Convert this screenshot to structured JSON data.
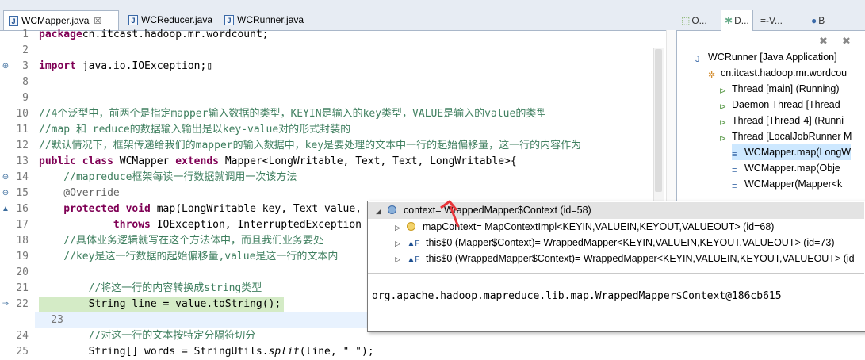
{
  "editor_tabs": [
    {
      "label": "WCMapper.java",
      "close": "☒",
      "active": true
    },
    {
      "label": "WCReducer.java",
      "active": false
    },
    {
      "label": "WCRunner.java",
      "active": false
    }
  ],
  "right_tabs": [
    {
      "label": "O..."
    },
    {
      "label": "D..."
    },
    {
      "label": "=-V..."
    },
    {
      "label": "B"
    }
  ],
  "code_lines": [
    {
      "n": "1",
      "parts": [
        [
          "kw",
          "package"
        ],
        [
          "",
          "cn.itcast.hadoop.mr.wordcount;"
        ]
      ]
    },
    {
      "n": "2",
      "parts": []
    },
    {
      "n": "3",
      "marker": "⊕",
      "parts": [
        [
          "kw",
          "import"
        ],
        [
          "",
          " java.io.IOException;"
        ],
        [
          "",
          "▯"
        ]
      ]
    },
    {
      "n": "8",
      "parts": []
    },
    {
      "n": "9",
      "parts": []
    },
    {
      "n": "10",
      "parts": [
        [
          "cm",
          "//4个泛型中，前两个是指定mapper输入数据的类型，KEYIN是输入的key类型，VALUE是输入的value的类型"
        ]
      ]
    },
    {
      "n": "11",
      "parts": [
        [
          "cm",
          "//map 和 reduce的数据输入输出是以key-value对的形式封装的"
        ]
      ]
    },
    {
      "n": "12",
      "parts": [
        [
          "cm",
          "//默认情况下，框架传递给我们的mapper的输入数据中，key是要处理的文本中一行的起始偏移量，这一行的内容作为"
        ]
      ]
    },
    {
      "n": "13",
      "parts": [
        [
          "kw",
          "public class "
        ],
        [
          "",
          "WCMapper "
        ],
        [
          "kw",
          "extends "
        ],
        [
          "",
          "Mapper<LongWritable, Text, Text, LongWritable>{"
        ]
      ]
    },
    {
      "n": "14",
      "marker": "⊖",
      "parts": [
        [
          "cm",
          "    //mapreduce框架每读一行数据就调用一次该方法"
        ]
      ]
    },
    {
      "n": "15",
      "marker": "⊖",
      "parts": [
        [
          "an",
          "    @Override"
        ]
      ]
    },
    {
      "n": "16",
      "marker": "▲",
      "parts": [
        [
          "kw",
          "    protected void "
        ],
        [
          "",
          "map(LongWritable key, Text value, Context context)"
        ]
      ]
    },
    {
      "n": "17",
      "parts": [
        [
          "kw",
          "            throws "
        ],
        [
          "",
          "IOException, InterruptedException"
        ]
      ]
    },
    {
      "n": "18",
      "parts": [
        [
          "cm",
          "    //具体业务逻辑就写在这个方法体中，而且我们业务要处"
        ]
      ]
    },
    {
      "n": "19",
      "parts": [
        [
          "cm",
          "    //key是这一行数据的起始偏移量,value是这一行的文本内"
        ]
      ]
    },
    {
      "n": "20",
      "parts": []
    },
    {
      "n": "21",
      "parts": [
        [
          "cm",
          "        //将这一行的内容转换成string类型"
        ]
      ]
    },
    {
      "n": "22",
      "marker": "⇒",
      "highlight": true,
      "parts": [
        [
          "",
          "        String line = value.toString();"
        ]
      ]
    },
    {
      "n": "23",
      "current": true,
      "parts": []
    },
    {
      "n": "24",
      "parts": [
        [
          "cm",
          "        //对这一行的文本按特定分隔符切分"
        ]
      ]
    },
    {
      "n": "25",
      "parts": [
        [
          "",
          "        String[] words = StringUtils."
        ],
        [
          "ital",
          "split"
        ],
        [
          "",
          "(line, \" \");"
        ]
      ]
    }
  ],
  "debug_tree": [
    {
      "label": "WCRunner [Java Application]",
      "icon": "app-icon"
    },
    {
      "label": "cn.itcast.hadoop.mr.wordcou",
      "icon": "gear-icon"
    },
    {
      "label": "Thread [main] (Running)",
      "icon": "thread-icon"
    },
    {
      "label": "Daemon Thread [Thread-",
      "icon": "thread-icon"
    },
    {
      "label": "Thread [Thread-4] (Runni",
      "icon": "thread-icon"
    },
    {
      "label": "Thread [LocalJobRunner M",
      "icon": "thread-icon"
    },
    {
      "label": "WCMapper.map(LongW",
      "icon": "frame-icon",
      "selected": true
    },
    {
      "label": "WCMapper.map(Obje",
      "icon": "frame-icon"
    },
    {
      "label": "WCMapper(Mapper<k",
      "icon": "frame-icon"
    }
  ],
  "popup": {
    "root": "context= WrappedMapper$Context  (id=58)",
    "children": [
      "mapContext= MapContextImpl<KEYIN,VALUEIN,KEYOUT,VALUEOUT>  (id=68)",
      "this$0 (Mapper$Context)= WrappedMapper<KEYIN,VALUEIN,KEYOUT,VALUEOUT>  (id=73)",
      "this$0 (WrappedMapper$Context)= WrappedMapper<KEYIN,VALUEIN,KEYOUT,VALUEOUT>  (id"
    ],
    "detail": "org.apache.hadoop.mapreduce.lib.map.WrappedMapper$Context@186cb615"
  },
  "colors": {
    "keyword": "#7f0055",
    "comment": "#3f7f5f",
    "annotation": "#646464",
    "highlight": "#d4ebc6",
    "arrow": "#e8353a"
  }
}
